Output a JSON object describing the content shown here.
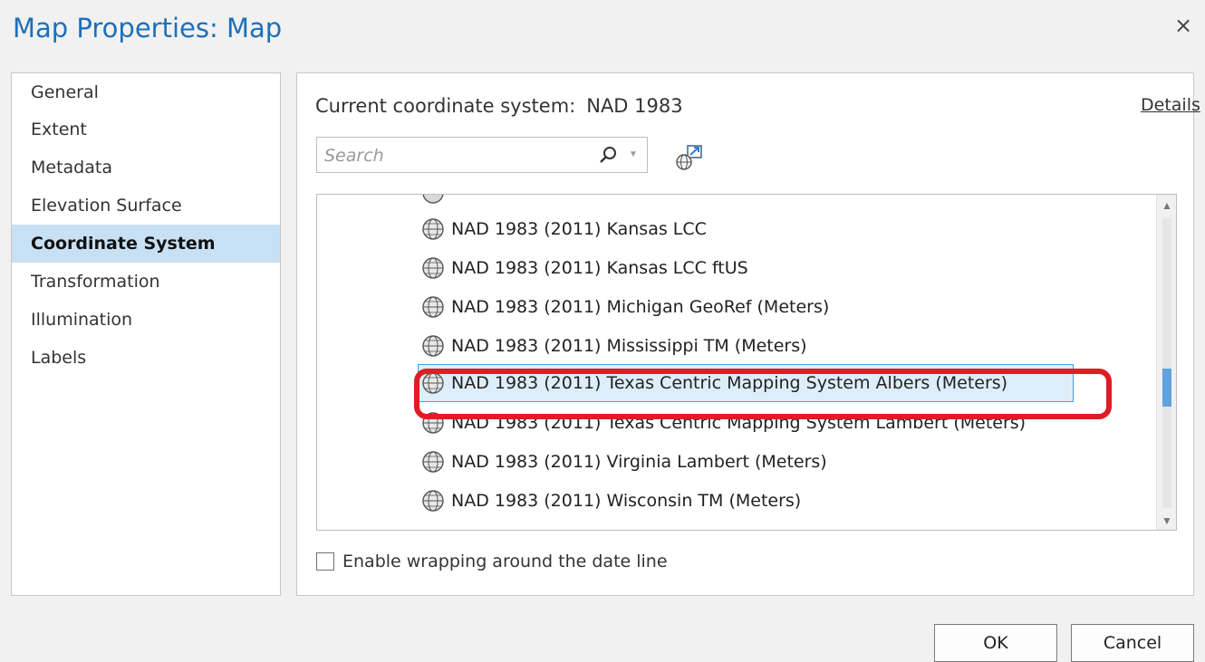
{
  "dialog": {
    "title": "Map Properties: Map",
    "close_glyph": "×"
  },
  "nav": {
    "items": [
      {
        "label": "General"
      },
      {
        "label": "Extent"
      },
      {
        "label": "Metadata"
      },
      {
        "label": "Elevation Surface"
      },
      {
        "label": "Coordinate System",
        "selected": true
      },
      {
        "label": "Transformation"
      },
      {
        "label": "Illumination"
      },
      {
        "label": "Labels"
      }
    ]
  },
  "coordinate_system": {
    "current_label": "Current coordinate system:",
    "current_value": "NAD 1983",
    "details_link": "Details",
    "search_placeholder": "Search",
    "search_icon": "search-icon",
    "list": [
      {
        "label": "NAD 1983 (2011) Kansas LCC"
      },
      {
        "label": "NAD 1983 (2011) Kansas LCC ftUS"
      },
      {
        "label": "NAD 1983 (2011) Michigan GeoRef (Meters)"
      },
      {
        "label": "NAD 1983 (2011) Mississippi TM (Meters)"
      },
      {
        "label": "NAD 1983 (2011) Texas Centric Mapping System Albers (Meters)",
        "selected": true
      },
      {
        "label": "NAD 1983 (2011) Texas Centric Mapping System Lambert (Meters)"
      },
      {
        "label": "NAD 1983 (2011) Virginia Lambert (Meters)"
      },
      {
        "label": "NAD 1983 (2011) Wisconsin TM (Meters)"
      }
    ],
    "wrap_label": "Enable wrapping around the date line"
  },
  "buttons": {
    "ok": "OK",
    "cancel": "Cancel"
  },
  "colors": {
    "title": "#1f6fb8",
    "selection": "#c8e0f4",
    "highlight_ring": "#e11b24",
    "scroll_thumb": "#5fa2dd"
  }
}
